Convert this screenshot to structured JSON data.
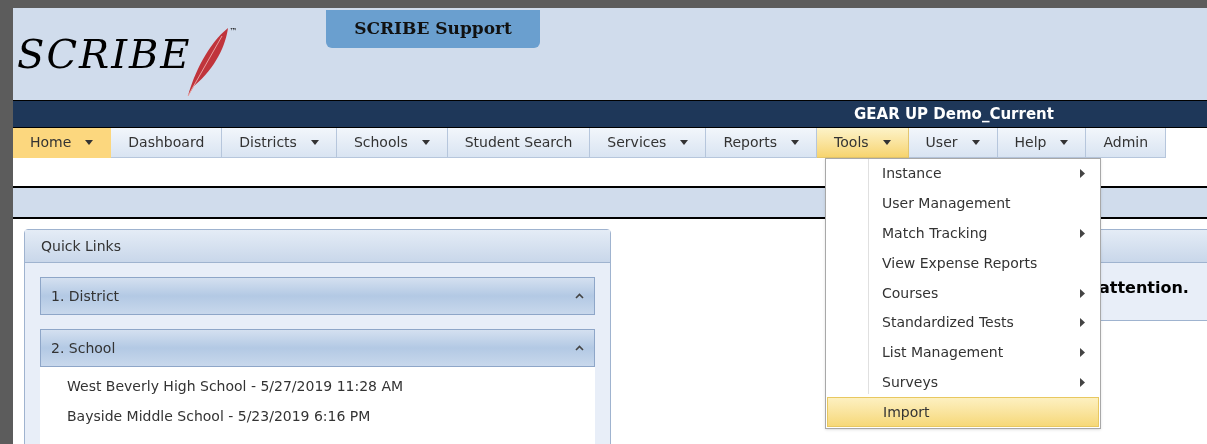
{
  "logo": {
    "wordmark": "SCRIBE",
    "trademark": "™"
  },
  "support_button": "SCRIBE Support",
  "instance_name": "GEAR UP Demo_Current",
  "nav": [
    {
      "label": "Home",
      "dropdown": true,
      "selected": true,
      "open": false
    },
    {
      "label": "Dashboard",
      "dropdown": false,
      "selected": false,
      "open": false
    },
    {
      "label": "Districts",
      "dropdown": true,
      "selected": false,
      "open": false
    },
    {
      "label": "Schools",
      "dropdown": true,
      "selected": false,
      "open": false
    },
    {
      "label": "Student Search",
      "dropdown": false,
      "selected": false,
      "open": false
    },
    {
      "label": "Services",
      "dropdown": true,
      "selected": false,
      "open": false
    },
    {
      "label": "Reports",
      "dropdown": true,
      "selected": false,
      "open": false
    },
    {
      "label": "Tools",
      "dropdown": true,
      "selected": false,
      "open": true
    },
    {
      "label": "User",
      "dropdown": true,
      "selected": false,
      "open": false
    },
    {
      "label": "Help",
      "dropdown": true,
      "selected": false,
      "open": false
    },
    {
      "label": "Admin",
      "dropdown": false,
      "selected": false,
      "open": false
    }
  ],
  "tools_menu": [
    {
      "label": "Instance",
      "submenu": true,
      "selected": false
    },
    {
      "label": "User Management",
      "submenu": false,
      "selected": false
    },
    {
      "label": "Match Tracking",
      "submenu": true,
      "selected": false
    },
    {
      "label": "View Expense Reports",
      "submenu": false,
      "selected": false
    },
    {
      "label": "Courses",
      "submenu": true,
      "selected": false
    },
    {
      "label": "Standardized Tests",
      "submenu": true,
      "selected": false
    },
    {
      "label": "List Management",
      "submenu": true,
      "selected": false
    },
    {
      "label": "Surveys",
      "submenu": true,
      "selected": false
    },
    {
      "label": "Import",
      "submenu": false,
      "selected": true
    }
  ],
  "quick_links": {
    "title": "Quick Links",
    "sections": [
      {
        "title": "1. District",
        "expanded": true
      },
      {
        "title": "2. School",
        "expanded": true,
        "links": [
          "West Beverly High School - 5/27/2019 11:28 AM",
          "Bayside Middle School - 5/23/2019 6:16 PM"
        ]
      }
    ]
  },
  "notice_panel": {
    "message": "attention."
  }
}
